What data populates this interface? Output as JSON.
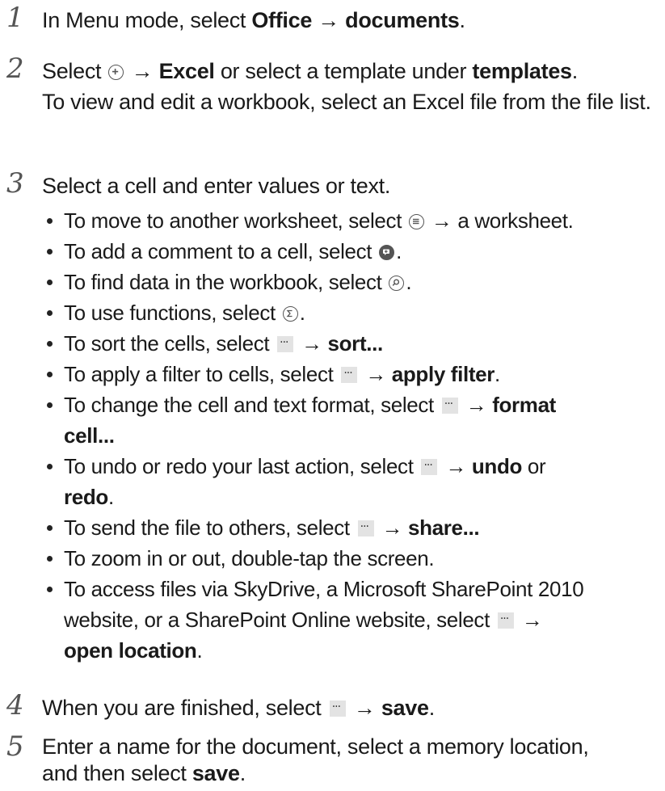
{
  "steps": [
    {
      "num": "1",
      "parts": [
        "In Menu mode, select ",
        "Office",
        " → ",
        "documents",
        "."
      ]
    },
    {
      "num": "2",
      "parts": [
        "Select ",
        " → ",
        "Excel",
        " or select a template under ",
        "templates",
        "."
      ],
      "extra": "To view and edit a workbook, select an Excel file from the file list."
    },
    {
      "num": "3",
      "text": "Select a cell and enter values or text.",
      "bullets": [
        {
          "a": "To move to another worksheet, select ",
          "b": " → a worksheet."
        },
        {
          "a": "To add a comment to a cell, select ",
          "b": "."
        },
        {
          "a": "To find data in the workbook, select ",
          "b": "."
        },
        {
          "a": "To use functions, select ",
          "b": "."
        },
        {
          "a": "To sort the cells, select ",
          "arrow": " → ",
          "bold": "sort...",
          "b": ""
        },
        {
          "a": "To apply a filter to cells, select ",
          "arrow": " → ",
          "bold": "apply filter",
          "b": "."
        },
        {
          "a": "To change the cell and text format, select ",
          "arrow": " → ",
          "bold": "format",
          "bold2": "cell...",
          "b": ""
        },
        {
          "a": "To undo or redo your last action, select ",
          "arrow": " → ",
          "bold": "undo",
          "mid": " or",
          "bold2": "redo",
          "b": "."
        },
        {
          "a": "To send the file to others, select ",
          "arrow": " → ",
          "bold": "share...",
          "b": ""
        },
        {
          "a": "To zoom in or out, double-tap the screen.",
          "b": ""
        },
        {
          "a": "To access files via SkyDrive, a Microsoft SharePoint 2010",
          "a2": "website, or a SharePoint Online website, select ",
          "arrow": " →",
          "bold2": "open location",
          "b": "."
        }
      ]
    },
    {
      "num": "4",
      "parts": [
        "When you are finished, select ",
        " → ",
        "save",
        "."
      ]
    },
    {
      "num": "5",
      "line1": "Enter a name for the document, select a memory location,",
      "line2a": "and then select ",
      "line2b": "save",
      "line2c": "."
    }
  ],
  "icons": {
    "new_doc": "plus-circle-icon",
    "worksheet": "list-circle-icon",
    "comment": "comment-circle-icon",
    "find": "search-circle-icon",
    "function": "sigma-circle-icon",
    "more": "more-dots-icon"
  }
}
